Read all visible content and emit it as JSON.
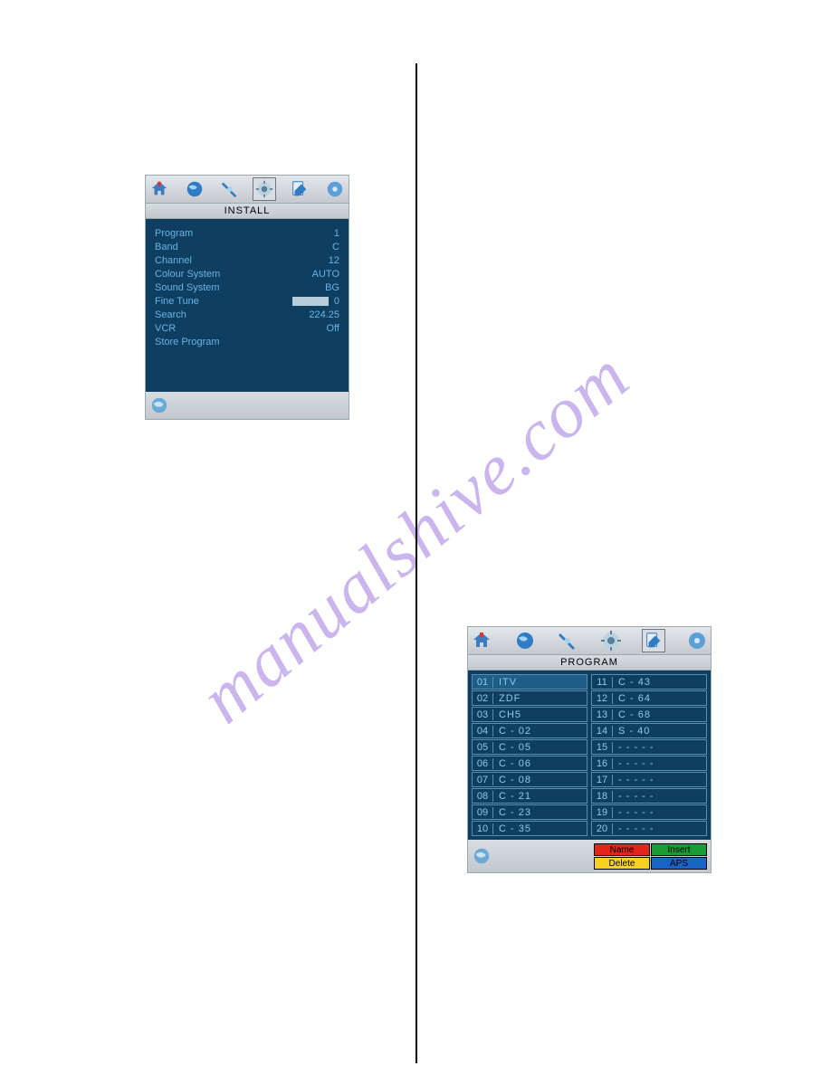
{
  "watermark": "manualshive.com",
  "install": {
    "title": "INSTALL",
    "rows": [
      {
        "label": "Program",
        "value": "1"
      },
      {
        "label": "Band",
        "value": "C"
      },
      {
        "label": "Channel",
        "value": "12"
      },
      {
        "label": "Colour System",
        "value": "AUTO"
      },
      {
        "label": "Sound System",
        "value": "BG"
      },
      {
        "label": "Fine Tune",
        "value": "0"
      },
      {
        "label": "Search",
        "value": "224.25"
      },
      {
        "label": "VCR",
        "value": "Off"
      },
      {
        "label": "Store Program",
        "value": ""
      }
    ]
  },
  "program": {
    "title": "PROGRAM",
    "left_col": [
      {
        "num": "01",
        "name": "ITV",
        "sel": true
      },
      {
        "num": "02",
        "name": "ZDF"
      },
      {
        "num": "03",
        "name": "CH5"
      },
      {
        "num": "04",
        "name": "C - 02"
      },
      {
        "num": "05",
        "name": "C - 05"
      },
      {
        "num": "06",
        "name": "C - 06"
      },
      {
        "num": "07",
        "name": "C - 08"
      },
      {
        "num": "08",
        "name": "C - 21"
      },
      {
        "num": "09",
        "name": "C - 23"
      },
      {
        "num": "10",
        "name": "C - 35"
      }
    ],
    "right_col": [
      {
        "num": "11",
        "name": "C - 43"
      },
      {
        "num": "12",
        "name": "C - 64"
      },
      {
        "num": "13",
        "name": "C - 68"
      },
      {
        "num": "14",
        "name": "S - 40"
      },
      {
        "num": "15",
        "name": "- - - - -"
      },
      {
        "num": "16",
        "name": "- - - - -"
      },
      {
        "num": "17",
        "name": "- - - - -"
      },
      {
        "num": "18",
        "name": "- - - - -"
      },
      {
        "num": "19",
        "name": "- - - - -"
      },
      {
        "num": "20",
        "name": "- - - - -"
      }
    ],
    "buttons": {
      "name": "Name",
      "insert": "Insert",
      "delete": "Delete",
      "aps": "APS"
    }
  }
}
